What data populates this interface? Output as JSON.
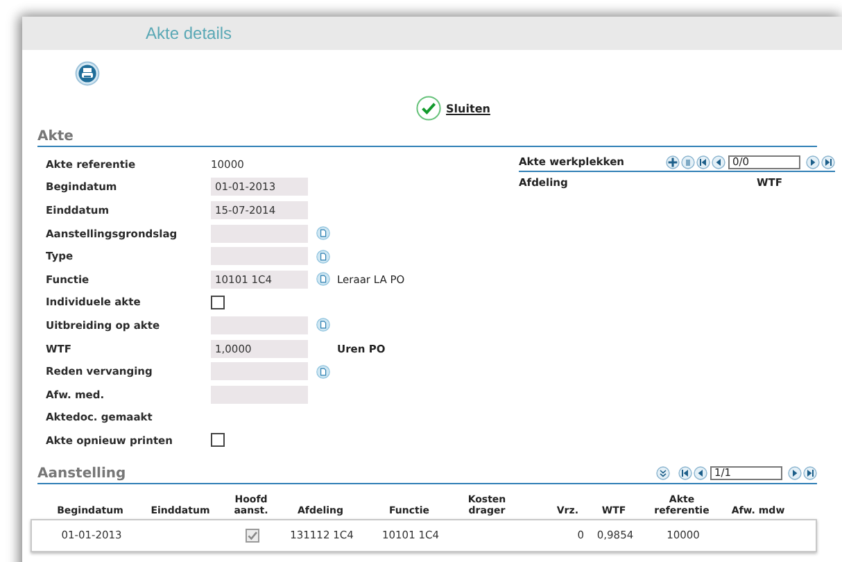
{
  "window": {
    "title": "Akte details"
  },
  "toolbar": {
    "close_link": "Sluiten"
  },
  "akte": {
    "heading": "Akte",
    "fields": [
      {
        "kind": "text",
        "label": "Akte referentie",
        "value": "10000"
      },
      {
        "kind": "input",
        "label": "Begindatum",
        "value": "01-01-2013",
        "lookup": false
      },
      {
        "kind": "input",
        "label": "Einddatum",
        "value": "15-07-2014",
        "lookup": false
      },
      {
        "kind": "input",
        "label": "Aanstellingsgrondslag",
        "lookup": true
      },
      {
        "kind": "input",
        "label": "Type",
        "lookup": true
      },
      {
        "kind": "input",
        "label": "Functie",
        "value": "10101  1C4",
        "lookup": true,
        "suffix": "Leraar LA PO"
      },
      {
        "kind": "checkbox",
        "label": "Individuele akte",
        "checked": false
      },
      {
        "kind": "input",
        "label": "Uitbreiding op akte",
        "lookup": true
      },
      {
        "kind": "input",
        "label": "WTF",
        "value": "1,0000",
        "lookup": false,
        "unit": "Uren PO"
      },
      {
        "kind": "input",
        "label": "Reden vervanging",
        "lookup": true
      },
      {
        "kind": "input",
        "label": "Afw. med.",
        "lookup": false
      },
      {
        "kind": "label",
        "label": "Aktedoc. gemaakt"
      },
      {
        "kind": "checkbox",
        "label": "Akte opnieuw printen",
        "checked": false
      }
    ],
    "werkplekken": {
      "title": "Akte werkplekken",
      "pager": "0/0",
      "columns": [
        "Afdeling",
        "WTF"
      ]
    }
  },
  "aanstelling": {
    "heading": "Aanstelling",
    "pager": "1/1",
    "columns": [
      "Begindatum",
      "Einddatum",
      "Hoofd aanst.",
      "Afdeling",
      "Functie",
      "Kosten drager",
      "Vrz.",
      "WTF",
      "Akte referentie",
      "Afw. mdw"
    ],
    "rows": [
      {
        "cells": [
          {
            "kind": "text",
            "text": "01-01-2013"
          },
          {
            "kind": "empty"
          },
          {
            "kind": "checkbox",
            "checked": true
          },
          {
            "kind": "text",
            "text": "131112 1C4"
          },
          {
            "kind": "text",
            "text": "10101  1C4"
          },
          {
            "kind": "empty"
          },
          {
            "kind": "text",
            "text": "0"
          },
          {
            "kind": "text",
            "text": "0,9854"
          },
          {
            "kind": "text",
            "text": "10000"
          },
          {
            "kind": "empty"
          }
        ]
      }
    ]
  }
}
